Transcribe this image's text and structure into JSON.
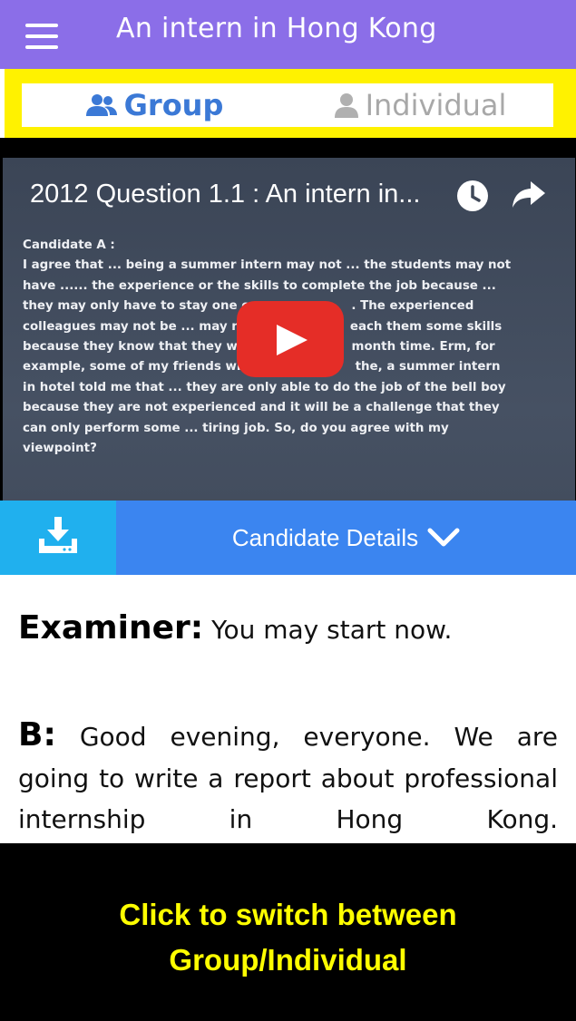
{
  "app": {
    "title": "An intern in Hong Kong",
    "menu_icon": "hamburger-menu-icon"
  },
  "tabs": [
    {
      "label": "Group",
      "icon": "group-icon",
      "active": true
    },
    {
      "label": "Individual",
      "icon": "user-icon",
      "active": false
    }
  ],
  "video": {
    "title": "2012 Question 1.1 : An intern in...",
    "slide_heading": "Candidate A :",
    "slide_lines": [
      "I agree that ... being a summer intern may not ... the students may not",
      "have ...... the experience or the skills to complete the job because ...",
      "they may only have to stay one o                        . The experienced",
      "colleagues may not be ... may no                        each them some skills",
      "because they know that they wil                         month time. Erm, for",
      "example, some of my friends wh                          the, a summer intern",
      "in hotel told me that ... they are only able to do the job of the bell boy",
      "because they are not experienced and it will be a challenge that they",
      "can only perform some ... tiring job. So, do you agree with my",
      "viewpoint?"
    ],
    "icons": [
      "clock-icon",
      "share-icon",
      "play-icon"
    ]
  },
  "details_bar": {
    "label": "Candidate Details",
    "download_icon": "download-icon",
    "chevron_icon": "chevron-down-icon"
  },
  "transcript": [
    {
      "speaker": "Examiner:",
      "text": "You may start now."
    },
    {
      "speaker": "B:",
      "text": "Good evening, everyone. We are going to write a report about professional internship in Hong Kong."
    }
  ],
  "caption": {
    "line1": "Click to switch between",
    "line2": "Group/Individual"
  },
  "colors": {
    "appbar": "#8b6ee8",
    "highlight": "#fff200",
    "tab_active": "#3b79d6",
    "details_bar": "#3b85f0",
    "download_button": "#20b0ee",
    "caption_text": "#ffff00"
  }
}
